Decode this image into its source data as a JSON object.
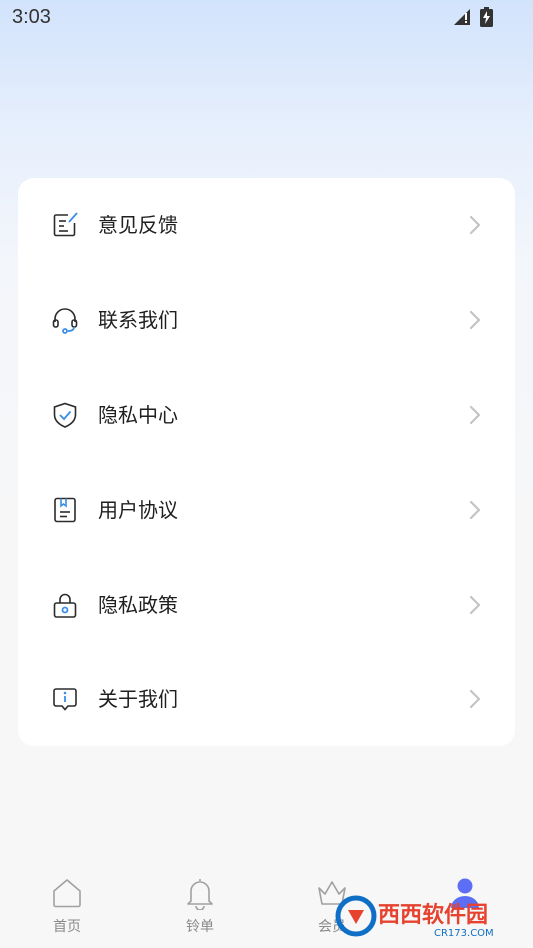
{
  "status_bar": {
    "time": "3:03",
    "icons": [
      "signal-icon",
      "battery-icon"
    ]
  },
  "menu": {
    "items": [
      {
        "label": "意见反馈",
        "icon": "feedback-icon"
      },
      {
        "label": "联系我们",
        "icon": "headset-icon"
      },
      {
        "label": "隐私中心",
        "icon": "shield-check-icon"
      },
      {
        "label": "用户协议",
        "icon": "agreement-document-icon"
      },
      {
        "label": "隐私政策",
        "icon": "lock-icon"
      },
      {
        "label": "关于我们",
        "icon": "info-icon"
      }
    ]
  },
  "tab_bar": {
    "tabs": [
      {
        "label": "首页",
        "icon": "home-icon",
        "active": false
      },
      {
        "label": "铃单",
        "icon": "bell-icon",
        "active": false
      },
      {
        "label": "会员",
        "icon": "crown-icon",
        "active": false
      },
      {
        "label": "",
        "icon": "user-icon",
        "active": true
      }
    ]
  },
  "watermark": {
    "text": "西西软件园",
    "subtext": "CR173.COM"
  },
  "colors": {
    "accent": "#3a8ee6",
    "icon_stroke": "#2b2b2b",
    "active_tab": "#5b6ef5",
    "inactive_tab": "#8a8a8a",
    "chevron": "#c4c4c4"
  }
}
